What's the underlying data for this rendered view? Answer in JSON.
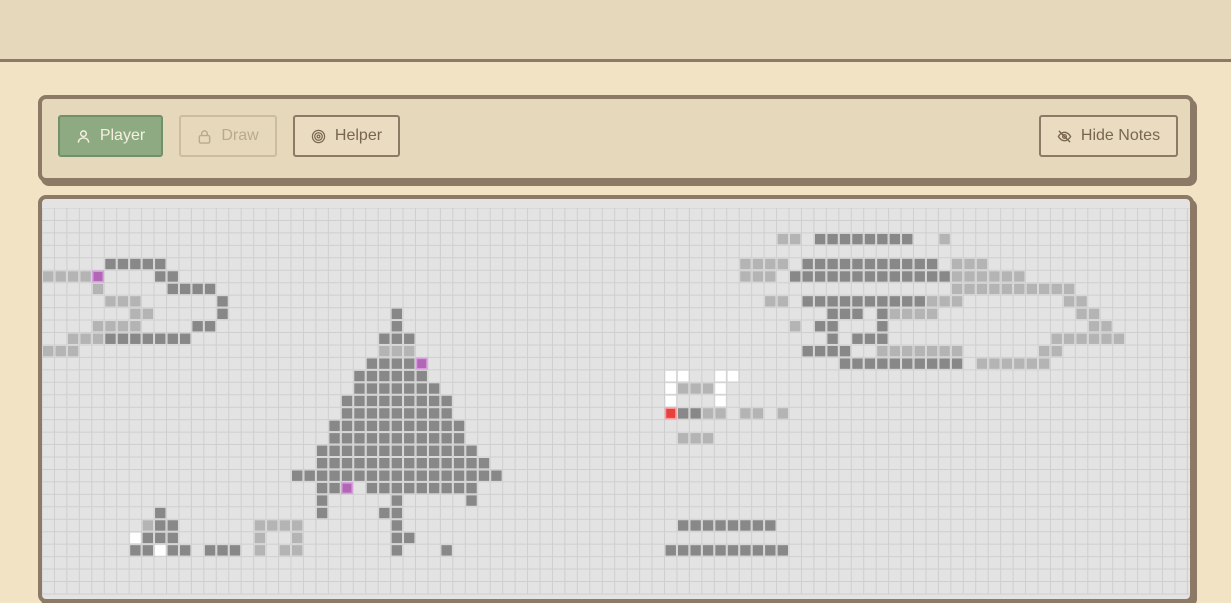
{
  "toolbar": {
    "player_label": "Player",
    "draw_label": "Draw",
    "helper_label": "Helper",
    "hide_notes_label": "Hide Notes"
  },
  "colors": {
    "background": "#f1e3c3",
    "panel": "#e6d8ba",
    "border": "#8d7a66",
    "player_active": "#8daa83",
    "grid_bg": "#e3e3e3",
    "grid_line": "#cfcfcf",
    "filled": "#888888",
    "hint": "#b4b4b4",
    "empty_white": "#ffffff",
    "marked": "#b266b6",
    "selected": "#e8413a"
  },
  "icons": {
    "player": "user-icon",
    "draw": "lock-icon",
    "helper": "target-icon",
    "hide_notes": "eye-off-icon"
  }
}
